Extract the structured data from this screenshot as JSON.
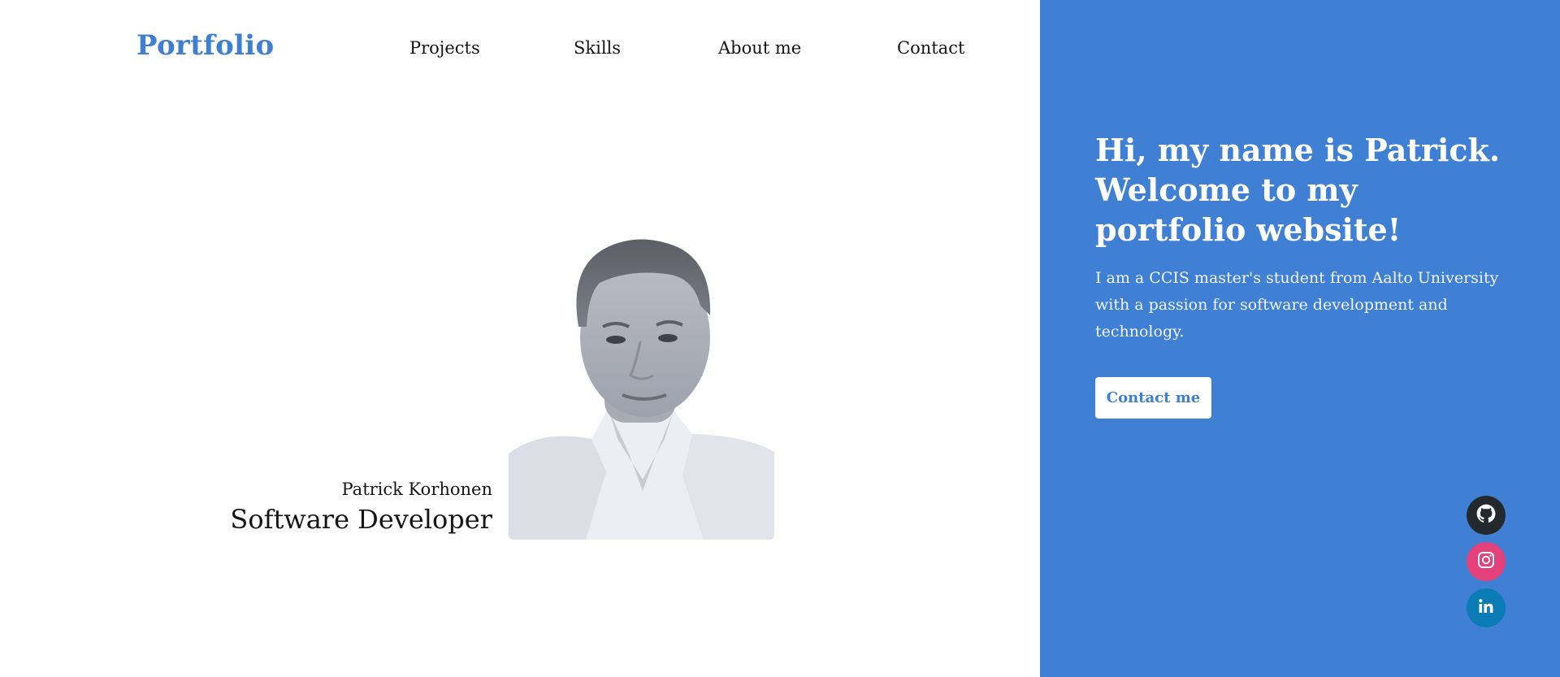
{
  "header": {
    "brand": "Portfolio",
    "nav": [
      "Projects",
      "Skills",
      "About me",
      "Contact"
    ]
  },
  "profile": {
    "name": "Patrick Korhonen",
    "role": "Software Developer",
    "photo_alt": "Portrait of Patrick Korhonen"
  },
  "hero": {
    "title": "Hi, my name is Patrick. Welcome to my portfolio website!",
    "text": "I am a CCIS master's student from Aalto University with a passion for software development and technology.",
    "button": "Contact me"
  },
  "social": {
    "links": [
      {
        "icon": "github-icon",
        "color": "#24292e"
      },
      {
        "icon": "instagram-icon",
        "color": "#e4407a"
      },
      {
        "icon": "linkedin-icon",
        "color": "#0a7bb5"
      }
    ]
  },
  "colors": {
    "accent": "#4080d4",
    "brand": "#3f7fd2"
  }
}
